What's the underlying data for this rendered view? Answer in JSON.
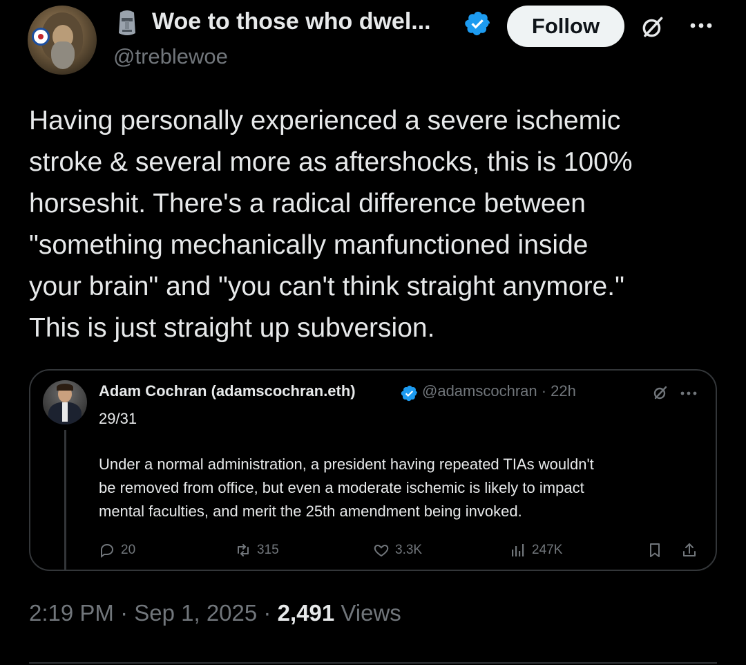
{
  "author": {
    "emoji_icon": "moai-icon",
    "display_name": "Woe to those who dwel...",
    "handle": "@treblewoe",
    "verified": true,
    "follow_label": "Follow"
  },
  "tweet": {
    "lines": [
      "Having personally experienced a severe ischemic",
      "stroke & several more as aftershocks, this is 100%",
      "horseshit. There's a radical difference between",
      "\"something mechanically manfunctioned inside",
      "your brain\" and \"you can't think straight anymore.\"",
      "This is just straight up subversion."
    ],
    "time": "2:19 PM",
    "date": "Sep 1, 2025",
    "views_count": "2,491",
    "views_label": "Views"
  },
  "quote": {
    "name": "Adam Cochran (adamscochran.eth)",
    "handle_time": "@adamscochran · 22h",
    "counter": "29/31",
    "body_lines": [
      "Under a normal administration, a president having repeated TIAs wouldn't",
      "be removed from office, but even a moderate ischemic is likely to impact",
      "mental faculties, and merit the 25th amendment being invoked."
    ],
    "actions": {
      "replies": "20",
      "reposts": "315",
      "likes": "3.3K",
      "views": "247K"
    }
  },
  "colors": {
    "background": "#000000",
    "text": "#e7e9ea",
    "muted": "#71767b",
    "verified_blue": "#1d9bf0",
    "border": "#333639"
  }
}
